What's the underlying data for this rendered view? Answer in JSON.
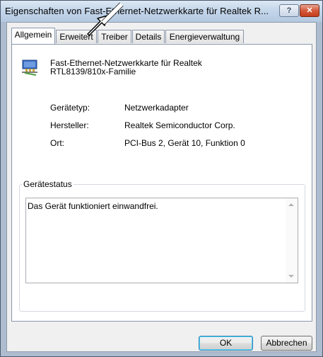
{
  "window": {
    "title": "Eigenschaften von Fast-Ethernet-Netzwerkkarte für Realtek R...",
    "help_label": "?",
    "close_label": "✕"
  },
  "tabs": [
    {
      "label": "Allgemein",
      "active": true
    },
    {
      "label": "Erweitert",
      "active": false
    },
    {
      "label": "Treiber",
      "active": false
    },
    {
      "label": "Details",
      "active": false
    },
    {
      "label": "Energieverwaltung",
      "active": false
    }
  ],
  "device": {
    "name_line1": "Fast-Ethernet-Netzwerkkarte für Realtek",
    "name_line2": "RTL8139/810x-Familie",
    "icon": "network-adapter-icon"
  },
  "properties": [
    {
      "label": "Gerätetyp:",
      "value": "Netzwerkadapter"
    },
    {
      "label": "Hersteller:",
      "value": "Realtek Semiconductor Corp."
    },
    {
      "label": "Ort:",
      "value": "PCI-Bus 2, Gerät 10, Funktion 0"
    }
  ],
  "status": {
    "group_title": "Gerätestatus",
    "text": "Das Gerät funktioniert einwandfrei."
  },
  "buttons": {
    "ok": "OK",
    "cancel": "Abbrechen"
  },
  "colors": {
    "title_bar": "#c4d6ea",
    "close_button": "#c43c1c",
    "ok_focus": "#3c7fb1"
  }
}
